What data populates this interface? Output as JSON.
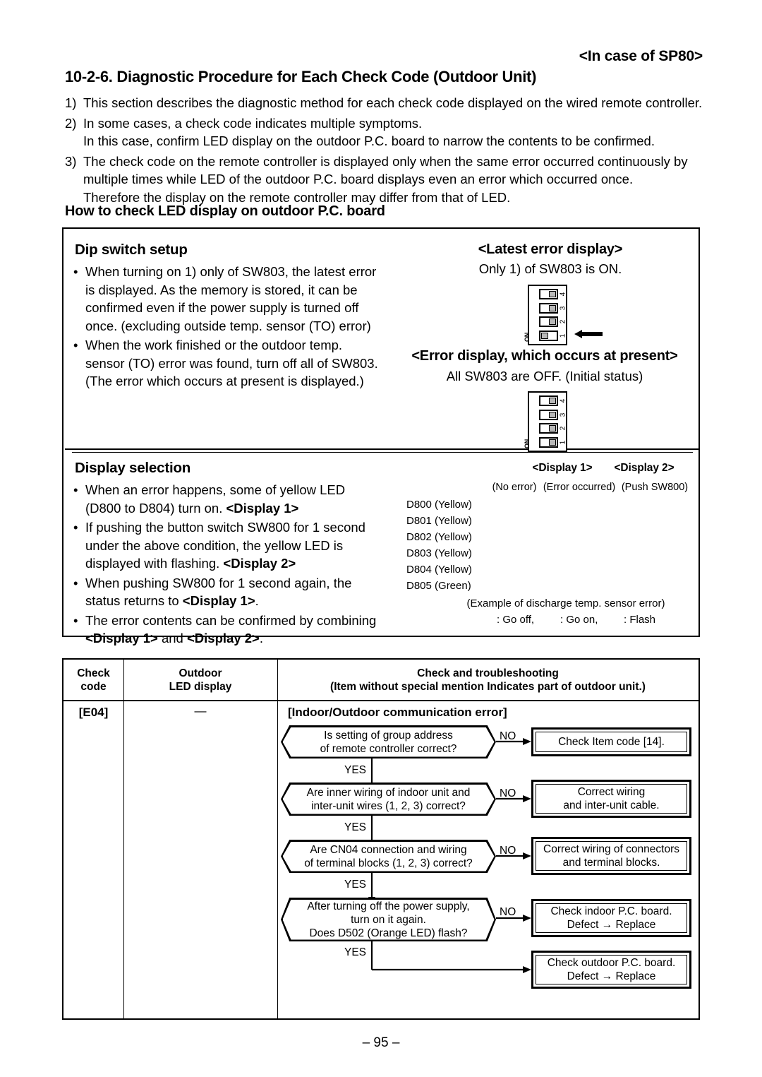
{
  "header": {
    "variant": "<In case of SP80>",
    "section_number": "10-2-6.",
    "section_title": "Diagnostic Procedure for Each Check Code (Outdoor Unit)"
  },
  "intro": [
    {
      "num": "1)",
      "lines": [
        "This section describes the diagnostic method for each check code displayed on the wired remote controller."
      ]
    },
    {
      "num": "2)",
      "lines": [
        "In some cases, a check code indicates multiple symptoms.",
        "In this case, confirm LED display on the outdoor P.C. board to narrow the contents to be confirmed."
      ]
    },
    {
      "num": "3)",
      "lines": [
        "The check code on the remote controller is displayed only when the same error occurred continuously by",
        "multiple times while LED of the outdoor P.C. board displays even an error which occurred once.",
        "Therefore the display on the remote controller may differ from that of LED."
      ]
    }
  ],
  "subheading": "How to check LED display on outdoor P.C. board",
  "dip_section": {
    "title": "Dip switch setup",
    "bullets": [
      [
        "When turning on 1) only of SW803, the latest error",
        "is displayed. As the memory is stored, it can be",
        "confirmed even if the power supply is turned off",
        "once. (excluding outside temp. sensor (TO) error)"
      ],
      [
        "When the work finished or the outdoor temp.",
        "sensor (TO) error was found, turn off all of SW803.",
        "(The error which occurs at present is displayed.)"
      ]
    ],
    "latest": {
      "heading": "<Latest error display>",
      "note": "Only 1) of SW803 is ON.",
      "on_label": "ON",
      "switch_numbers": [
        "4",
        "3",
        "2",
        "1"
      ],
      "switch_states": [
        "off",
        "off",
        "off",
        "on"
      ],
      "arrow_icon": "left-arrow-icon"
    },
    "present": {
      "heading": "<Error display, which occurs at present>",
      "note": "All SW803 are OFF. (Initial status)",
      "on_label": "ON",
      "switch_numbers": [
        "4",
        "3",
        "2",
        "1"
      ],
      "switch_states": [
        "off",
        "off",
        "off",
        "off"
      ]
    }
  },
  "display_section": {
    "title": "Display selection",
    "bullets": [
      [
        "When an error happens, some of yellow LED",
        "(D800 to D804) turn on. <Display 1>"
      ],
      [
        "If pushing the button switch SW800 for 1 second",
        "under the above condition, the yellow LED is",
        "displayed with flashing. <Display 2>"
      ],
      [
        "When pushing SW800 for 1 second again, the",
        "status returns to <Display 1>."
      ],
      [
        "The error contents can be confirmed by combining",
        "<Display 1> and <Display 2>."
      ]
    ],
    "led_table": {
      "col_headers": [
        "<Display 1>",
        "<Display 2>"
      ],
      "col_subheaders": [
        "(No error)",
        "(Error occurred)",
        "(Push SW800)"
      ],
      "rows": [
        "D800 (Yellow)",
        "D801 (Yellow)",
        "D802 (Yellow)",
        "D803 (Yellow)",
        "D804 (Yellow)",
        "D805 (Green)"
      ],
      "example_note": "(Example of discharge temp. sensor error)",
      "legend": [
        ": Go off,",
        ": Go on,",
        ": Flash"
      ]
    }
  },
  "check_table": {
    "headers": {
      "code": [
        "Check",
        "code"
      ],
      "led": [
        "Outdoor",
        "LED display"
      ],
      "trouble_main": "Check and troubleshooting",
      "trouble_sub": "(Item without special mention Indicates part of outdoor unit.)"
    },
    "row": {
      "code": "[E04]",
      "led": "—",
      "error_title": "[Indoor/Outdoor communication error]"
    },
    "flow": {
      "decisions": [
        {
          "lines": [
            "Is setting of group address",
            "of remote controller correct?"
          ],
          "no_label": "NO",
          "yes_label": "YES"
        },
        {
          "lines": [
            "Are inner wiring of indoor unit and",
            "inter-unit wires (1, 2, 3) correct?"
          ],
          "no_label": "NO",
          "yes_label": "YES"
        },
        {
          "lines": [
            "Are CN04 connection and wiring",
            "of terminal blocks (1, 2, 3) correct?"
          ],
          "no_label": "NO",
          "yes_label": "YES"
        },
        {
          "lines": [
            "After turning off the power supply,",
            "turn on it again.",
            "Does D502 (Orange LED) flash?"
          ],
          "no_label": "NO",
          "yes_label": "YES"
        }
      ],
      "results": [
        {
          "lines": [
            "Check Item code [14]."
          ]
        },
        {
          "lines": [
            "Correct wiring",
            "and inter-unit cable."
          ]
        },
        {
          "lines": [
            "Correct wiring of connectors",
            "and terminal blocks."
          ]
        },
        {
          "lines": [
            "Check indoor P.C. board.",
            "Defect → Replace"
          ]
        },
        {
          "lines": [
            "Check outdoor P.C. board.",
            "Defect → Replace"
          ]
        }
      ]
    }
  },
  "page_number": "– 95 –"
}
